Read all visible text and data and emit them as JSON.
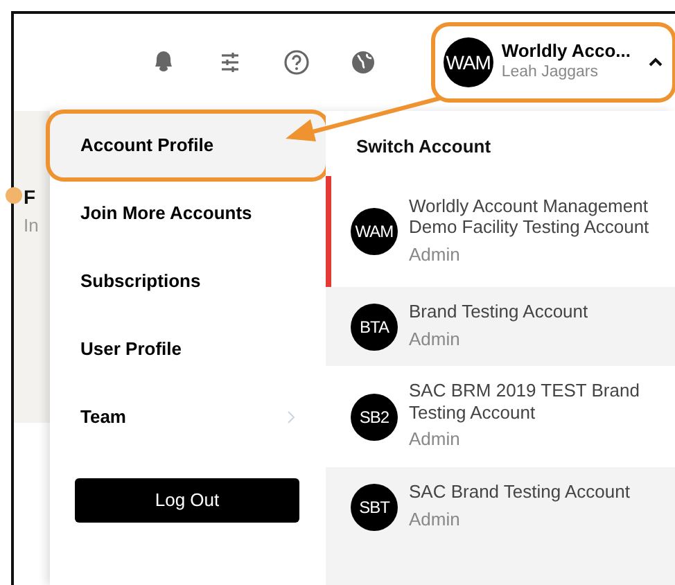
{
  "background": {
    "title": "F",
    "subtitle": "In"
  },
  "account_button": {
    "avatar": "WAM",
    "name": "Worldly Acco...",
    "user": "Leah Jaggars",
    "expanded": true,
    "highlighted": true
  },
  "menu": {
    "items": [
      {
        "label": "Account Profile",
        "selected": true,
        "highlighted": true,
        "submenu": false
      },
      {
        "label": "Join More Accounts",
        "selected": false,
        "highlighted": false,
        "submenu": false
      },
      {
        "label": "Subscriptions",
        "selected": false,
        "highlighted": false,
        "submenu": false
      },
      {
        "label": "User Profile",
        "selected": false,
        "highlighted": false,
        "submenu": false
      },
      {
        "label": "Team",
        "selected": false,
        "highlighted": false,
        "submenu": true
      }
    ],
    "logout": "Log Out"
  },
  "switch_account": {
    "title": "Switch Account",
    "accounts": [
      {
        "initials": "WAM",
        "name": "Worldly Account Management Demo Facility Testing Account",
        "role": "Admin",
        "selected": true
      },
      {
        "initials": "BTA",
        "name": "Brand Testing Account",
        "role": "Admin",
        "selected": false
      },
      {
        "initials": "SB2",
        "name": "SAC BRM 2019 TEST Brand Testing Account",
        "role": "Admin",
        "selected": false
      },
      {
        "initials": "SBT",
        "name": "SAC Brand Testing Account",
        "role": "Admin",
        "selected": false
      }
    ]
  },
  "annotation": {
    "arrow": true
  }
}
